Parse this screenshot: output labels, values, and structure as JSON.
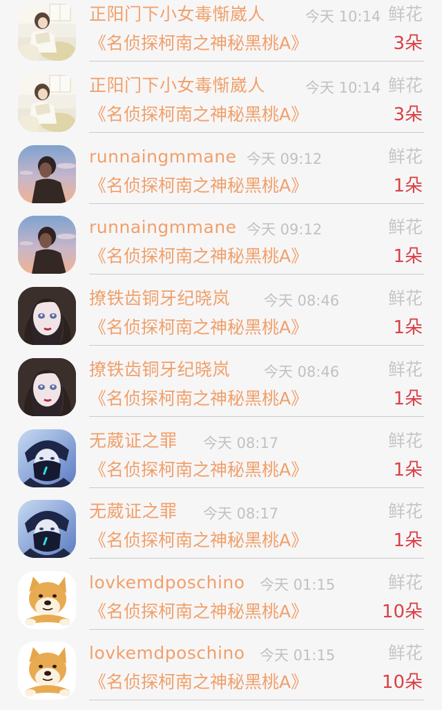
{
  "records": [
    {
      "name": "正阳门下小女毒惭崴人",
      "time": "今天 10:14",
      "type": "鲜花",
      "book": "《名侦探柯南之神秘黑桃A》",
      "count": "3朵",
      "avatar": "girl-reading-avatar"
    },
    {
      "name": "正阳门下小女毒惭崴人",
      "time": "今天 10:14",
      "type": "鲜花",
      "book": "《名侦探柯南之神秘黑桃A》",
      "count": "3朵",
      "avatar": "girl-reading-avatar"
    },
    {
      "name": "runnaingmmane",
      "time": "今天 09:12",
      "type": "鲜花",
      "book": "《名侦探柯南之神秘黑桃A》",
      "count": "1朵",
      "avatar": "boy-sunset-avatar"
    },
    {
      "name": "runnaingmmane",
      "time": "今天 09:12",
      "type": "鲜花",
      "book": "《名侦探柯南之神秘黑桃A》",
      "count": "1朵",
      "avatar": "boy-sunset-avatar"
    },
    {
      "name": "撩铁齿铜牙纪晓岚",
      "time": "今天 08:46",
      "type": "鲜花",
      "book": "《名侦探柯南之神秘黑桃A》",
      "count": "1朵",
      "avatar": "anime-girl-avatar"
    },
    {
      "name": "撩铁齿铜牙纪晓岚",
      "time": "今天 08:46",
      "type": "鲜花",
      "book": "《名侦探柯南之神秘黑桃A》",
      "count": "1朵",
      "avatar": "anime-girl-avatar"
    },
    {
      "name": "无葳证之罪",
      "time": "今天 08:17",
      "type": "鲜花",
      "book": "《名侦探柯南之神秘黑桃A》",
      "count": "1朵",
      "avatar": "anime-boy-mask-avatar"
    },
    {
      "name": "无葳证之罪",
      "time": "今天 08:17",
      "type": "鲜花",
      "book": "《名侦探柯南之神秘黑桃A》",
      "count": "1朵",
      "avatar": "anime-boy-mask-avatar"
    },
    {
      "name": "lovkemdposchino",
      "time": "今天 01:15",
      "type": "鲜花",
      "book": "《名侦探柯南之神秘黑桃A》",
      "count": "10朵",
      "avatar": "doge-avatar"
    },
    {
      "name": "lovkemdposchino",
      "time": "今天 01:15",
      "type": "鲜花",
      "book": "《名侦探柯南之神秘黑桃A》",
      "count": "10朵",
      "avatar": "doge-avatar"
    }
  ],
  "colors": {
    "background": "#f7f6f7",
    "name": "#f0a06a",
    "time": "#c2c0c2",
    "type": "#c8c5c8",
    "count": "#d94045",
    "divider": "#c9c9c9"
  }
}
